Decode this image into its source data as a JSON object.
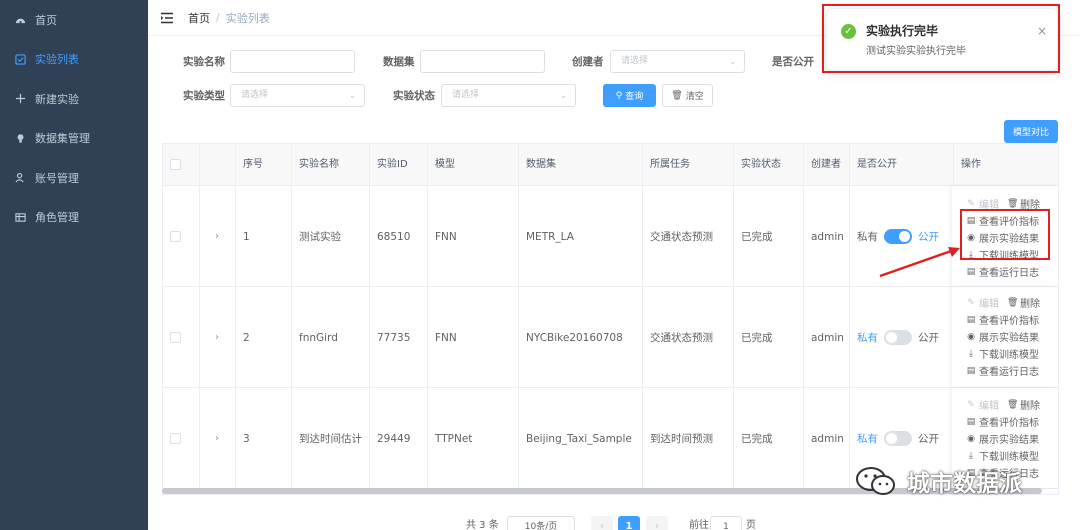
{
  "sidebar": {
    "items": [
      {
        "label": "首页",
        "icon": "dashboard-icon"
      },
      {
        "label": "实验列表",
        "icon": "checkbox-icon",
        "active": true
      },
      {
        "label": "新建实验",
        "icon": "plus-icon"
      },
      {
        "label": "数据集管理",
        "icon": "bulb-icon"
      },
      {
        "label": "账号管理",
        "icon": "user-icon"
      },
      {
        "label": "角色管理",
        "icon": "table-icon"
      }
    ]
  },
  "breadcrumb": {
    "home": "首页",
    "separator": "/",
    "current": "实验列表"
  },
  "filters": {
    "exp_name_label": "实验名称",
    "dataset_label": "数据集",
    "creator_label": "创建者",
    "creator_placeholder": "请选择",
    "public_label": "是否公开",
    "exp_type_label": "实验类型",
    "exp_type_placeholder": "请选择",
    "exp_status_label": "实验状态",
    "exp_status_placeholder": "请选择",
    "query_button": "查询",
    "clear_button": "清空"
  },
  "compare_button": "模型对比",
  "table": {
    "headers": [
      "序号",
      "实验名称",
      "实验ID",
      "模型",
      "数据集",
      "所属任务",
      "实验状态",
      "创建者",
      "是否公开",
      "操作"
    ],
    "rows": [
      {
        "index": "1",
        "name": "测试实验",
        "id": "68510",
        "model": "FNN",
        "dataset": "METR_LA",
        "task": "交通状态预测",
        "status": "已完成",
        "creator": "admin",
        "private_label": "私有",
        "public_label": "公开",
        "is_public": true
      },
      {
        "index": "2",
        "name": "fnnGird",
        "id": "77735",
        "model": "FNN",
        "dataset": "NYCBike20160708",
        "task": "交通状态预测",
        "status": "已完成",
        "creator": "admin",
        "private_label": "私有",
        "public_label": "公开",
        "is_public": false
      },
      {
        "index": "3",
        "name": "到达时间估计",
        "id": "29449",
        "model": "TTPNet",
        "dataset": "Beijing_Taxi_Sample",
        "task": "到达时间预测",
        "status": "已完成",
        "creator": "admin",
        "private_label": "私有",
        "public_label": "公开",
        "is_public": false
      }
    ],
    "ops": {
      "edit": "编辑",
      "delete": "删除",
      "view_metrics": "查看评价指标",
      "show_results": "展示实验结果",
      "download_model": "下载训练模型",
      "view_log": "查看运行日志"
    }
  },
  "pagination": {
    "total": "共 3 条",
    "page_size": "10条/页",
    "current_page": "1",
    "goto_label": "前往",
    "goto_value": "1",
    "page_unit": "页"
  },
  "notification": {
    "title": "实验执行完毕",
    "message": "测试实验实验执行完毕",
    "close": "×"
  },
  "watermark": "城市数据派",
  "colors": {
    "primary": "#409eff",
    "sidebar": "#304156",
    "success": "#67c23a",
    "annotation": "#e02020"
  }
}
